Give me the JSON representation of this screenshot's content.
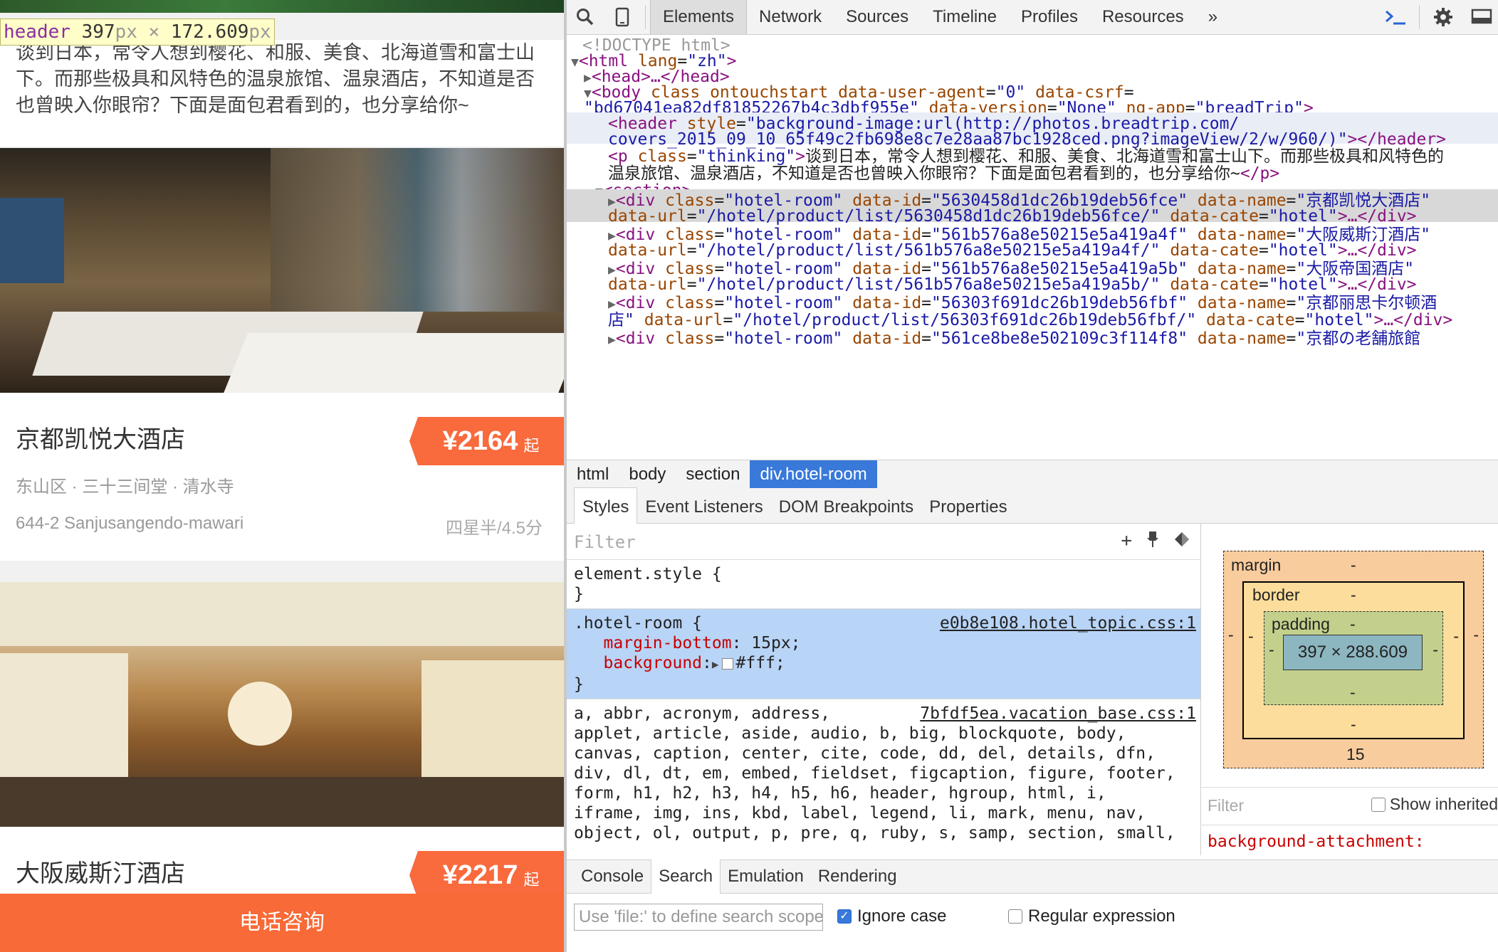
{
  "mobile": {
    "header_tooltip": {
      "tag": "header",
      "width": "397",
      "height": "172.609",
      "unit": "px",
      "times": "×"
    },
    "thinking_text": "谈到日本，常令人想到樱花、和服、美食、北海道雪和富士山下。而那些极具和风特色的温泉旅馆、温泉酒店，不知道是否也曾映入你眼帘？下面是面包君看到的，也分享给你~",
    "hotels": [
      {
        "name": "京都凯悦大酒店",
        "price": "¥2164",
        "price_suffix": "起",
        "area": "东山区 · 三十三间堂 · 清水寺",
        "address": "644-2 Sanjusangendo-mawari",
        "rating": "四星半/4.5分"
      },
      {
        "name": "大阪威斯汀酒店",
        "price": "¥2217",
        "price_suffix": "起"
      }
    ],
    "call_button": "电话咨询"
  },
  "devtools": {
    "toolbar": {
      "tabs": [
        "Elements",
        "Network",
        "Sources",
        "Timeline",
        "Profiles",
        "Resources"
      ],
      "more": "»",
      "icons": [
        "search-icon",
        "device-icon",
        "console-icon",
        "gear-icon",
        "dock-icon"
      ]
    },
    "dom": {
      "doctype": "<!DOCTYPE html>",
      "html_open": {
        "tag": "<html",
        "attr": "lang",
        "val": "\"zh\"",
        "end": ">"
      },
      "head": "<head>…</head>",
      "body_line1": {
        "tag": "<body",
        "a1": "class",
        "a2": "ontouchstart",
        "a3": "data-user-agent",
        "v3": "\"0\"",
        "a4": "data-csrf"
      },
      "body_line2": {
        "v4": "\"bd67041ea82df81852267b4c3dbf955e\"",
        "a5": "data-version",
        "v5": "\"None\"",
        "a6": "ng-app",
        "v6": "\"breadTrip\""
      },
      "header_line1": {
        "tag": "<header",
        "attr": "style",
        "val": "\"background-image:url(http://photos.breadtrip.com/"
      },
      "header_line2": {
        "val": "covers_2015_09_10_65f49c2fb698e8c7e28aa87bc1928ced.png?imageView/2/w/960/)\"",
        "end": "></header>"
      },
      "p_line1": {
        "tag": "<p",
        "attr": "class",
        "val": "\"thinking\"",
        "text": "谈到日本，常令人想到樱花、和服、美食、北海道雪和富士山下。而那些极具和风特色的"
      },
      "p_line2": {
        "text": "温泉旅馆、温泉酒店，不知道是否也曾映入你眼帘？下面是面包君看到的，也分享给你~",
        "end": "</p>"
      },
      "section": "<section>",
      "rooms": [
        {
          "id": "\"5630458d1dc26b19deb56fce\"",
          "name": "\"京都凯悦大酒店\"",
          "url": "\"/hotel/product/list/5630458d1dc26b19deb56fce/\""
        },
        {
          "id": "\"561b576a8e50215e5a419a4f\"",
          "name": "\"大阪威斯汀酒店\"",
          "url": "\"/hotel/product/list/561b576a8e50215e5a419a4f/\""
        },
        {
          "id": "\"561b576a8e50215e5a419a5b\"",
          "name": "\"大阪帝国酒店\"",
          "url": "\"/hotel/product/list/561b576a8e50215e5a419a5b/\""
        },
        {
          "id": "\"56303f691dc26b19deb56fbf\"",
          "name": "\"京都丽思卡尔顿酒",
          "name_wrap": "店\"",
          "url": "\"/hotel/product/list/56303f691dc26b19deb56fbf/\""
        },
        {
          "id": "\"561ce8be8e502109c3f114f8\"",
          "name": "\"京都の老舗旅館"
        }
      ],
      "room_tag": "<div",
      "room_class_attr": "class",
      "room_class_val": "\"hotel-room\"",
      "attr_id": "data-id",
      "attr_name": "data-name",
      "attr_url": "data-url",
      "attr_cate": "data-cate",
      "cate_val": "\"hotel\"",
      "room_end": ">…</div>"
    },
    "breadcrumbs": [
      "html",
      "body",
      "section",
      "div.hotel-room"
    ],
    "side_tabs": [
      "Styles",
      "Event Listeners",
      "DOM Breakpoints",
      "Properties"
    ],
    "styles": {
      "filter_placeholder": "Filter",
      "element_style": "element.style {",
      "close_brace": "}",
      "rule_selector": ".hotel-room {",
      "rule_source": "e0b8e108.hotel_topic.css:1",
      "prop1": "margin-bottom",
      "val1": "15px;",
      "prop2": "background",
      "val2": "#fff;",
      "base_source": "7bfdf5ea.vacation_base.css:1",
      "base_selectors": [
        "a, abbr, acronym, address,",
        "applet, article, aside, audio, b, big, blockquote, body,",
        "canvas, caption, center, cite, code, dd, del, details, dfn,",
        "div, dl, dt, em, embed, fieldset, figcaption, figure, footer,",
        "form, h1, h2, h3, h4, h5, h6, header, hgroup, html, i,",
        "iframe, img, ins, kbd, label, legend, li, mark, menu, nav,",
        "object, ol, output, p, pre, q, ruby, s, samp, section, small,"
      ]
    },
    "box_model": {
      "margin_label": "margin",
      "border_label": "border",
      "padding_label": "padding",
      "dash": "-",
      "content": "397 × 288.609",
      "margin_bottom": "15"
    },
    "computed": {
      "filter_placeholder": "Filter",
      "show_inherited": "Show inherited",
      "first_prop": "background-attachment:"
    },
    "drawer_tabs": [
      "Console",
      "Search",
      "Emulation",
      "Rendering"
    ],
    "search": {
      "placeholder": "Use 'file:' to define search scope",
      "ignore_case": "Ignore case",
      "regex": "Regular expression"
    }
  }
}
